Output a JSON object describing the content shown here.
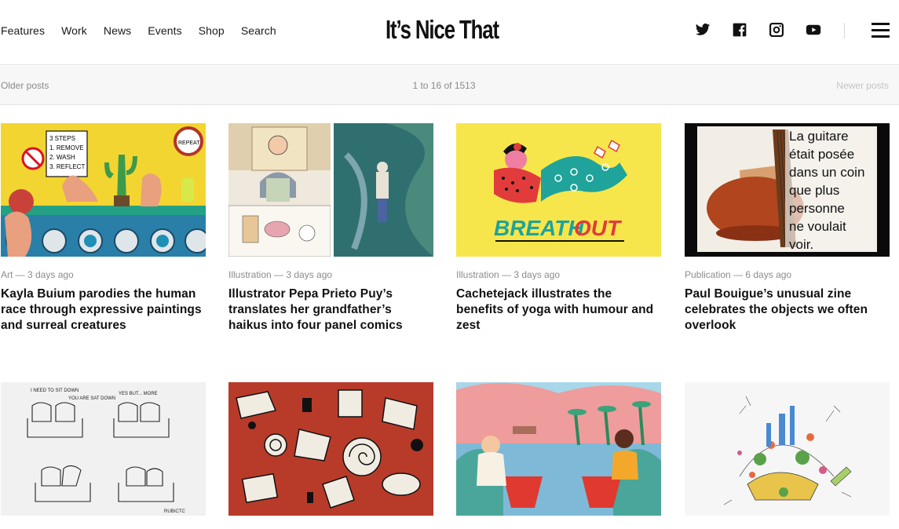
{
  "nav": {
    "items": [
      "Features",
      "Work",
      "News",
      "Events",
      "Shop",
      "Search"
    ]
  },
  "logo": "It’s Nice That",
  "social": [
    "twitter-icon",
    "facebook-icon",
    "instagram-icon",
    "youtube-icon"
  ],
  "pager": {
    "older": "Older posts",
    "count": "1 to 16 of 1513",
    "newer": "Newer posts"
  },
  "articles": [
    {
      "meta": "Art — 3 days ago",
      "title": "Kayla Buium parodies the human race through expressive paintings and surreal creatures"
    },
    {
      "meta": "Illustration — 3 days ago",
      "title": "Illustrator Pepa Prieto Puy’s translates her grandfather’s haikus into four panel comics"
    },
    {
      "meta": "Illustration — 3 days ago",
      "title": "Cachetejack illustrates the benefits of yoga with humour and zest"
    },
    {
      "meta": "Publication — 6 days ago",
      "title": "Paul Bouigue’s unusual zine celebrates the objects we often overlook"
    }
  ],
  "image_text": {
    "steps_sign": [
      "3 STEPS",
      "1. REMOVE",
      "2. WASH",
      "3. REFLECT"
    ],
    "repeat_sign": "REPEAT",
    "breath": "BREATH",
    "out": "OUT",
    "zine_lines": [
      "La guitare",
      "était posée",
      "dans un coin",
      "que plus",
      "personne",
      "ne voulait",
      "voir."
    ],
    "comic_1": "I NEED TO SIT DOWN",
    "comic_2": "YOU ARE SAT DOWN",
    "comic_3": "YES BUT... MORE",
    "comic_sign": "RUBICTC"
  }
}
